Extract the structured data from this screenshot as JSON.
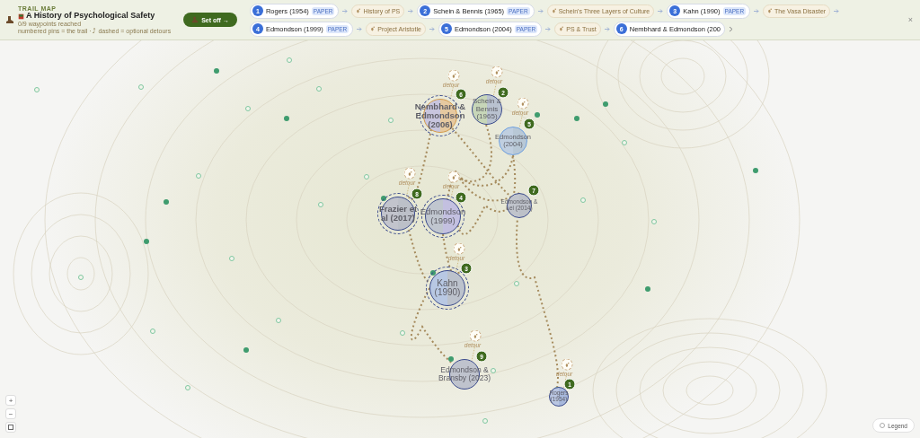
{
  "header": {
    "eyebrow": "TRAIL MAP",
    "title": "A History of Psychological Safety",
    "progress": "0/9 waypoints reached",
    "hint": "numbered pins = the trail · ⤴ dashed = optional detours",
    "start_button": "Set off →"
  },
  "trail": [
    {
      "kind": "stop",
      "number": "1",
      "label": "Rogers (1954)",
      "badge": "PAPER"
    },
    {
      "kind": "detour",
      "label": "History of PS"
    },
    {
      "kind": "stop",
      "number": "2",
      "label": "Schein & Bennis (1965)",
      "badge": "PAPER"
    },
    {
      "kind": "detour",
      "label": "Schein's Three Layers of Culture"
    },
    {
      "kind": "stop",
      "number": "3",
      "label": "Kahn (1990)",
      "badge": "PAPER"
    },
    {
      "kind": "detour",
      "label": "The Vasa Disaster"
    },
    {
      "kind": "stop",
      "number": "4",
      "label": "Edmondson (1999)",
      "badge": "PAPER"
    },
    {
      "kind": "detour",
      "label": "Project Aristotle"
    },
    {
      "kind": "stop",
      "number": "5",
      "label": "Edmondson (2004)",
      "badge": "PAPER"
    },
    {
      "kind": "detour",
      "label": "PS & Trust"
    },
    {
      "kind": "stop",
      "number": "6",
      "label": "Nembhard & Edmondson (200"
    }
  ],
  "close": "×",
  "map": {
    "stops": [
      {
        "number": "6",
        "label": "Nembhard & Edmondson (2006)"
      },
      {
        "number": "2",
        "label": "Schein & Bennis (1965)"
      },
      {
        "number": "5",
        "label": "Edmondson (2004)"
      },
      {
        "number": "8",
        "label": "Frazier et al (2017)"
      },
      {
        "number": "4",
        "label": "Edmondson (1999)"
      },
      {
        "number": "7",
        "label": "Edmondson & Lei (2014)"
      },
      {
        "number": "3",
        "label": "Kahn (1990)"
      },
      {
        "number": "9",
        "label": "Edmondson & Bransby (2023)"
      },
      {
        "number": "1",
        "label": "Rogers (1954)"
      }
    ],
    "detours": [
      {
        "label": "detour"
      },
      {
        "label": "detour"
      },
      {
        "label": "detour"
      },
      {
        "label": "detour"
      },
      {
        "label": "detour"
      },
      {
        "label": "detour"
      },
      {
        "label": "detour"
      },
      {
        "label": "detour"
      }
    ]
  },
  "controls": {
    "zoom_in": "+",
    "zoom_out": "−",
    "legend": "Legend"
  }
}
